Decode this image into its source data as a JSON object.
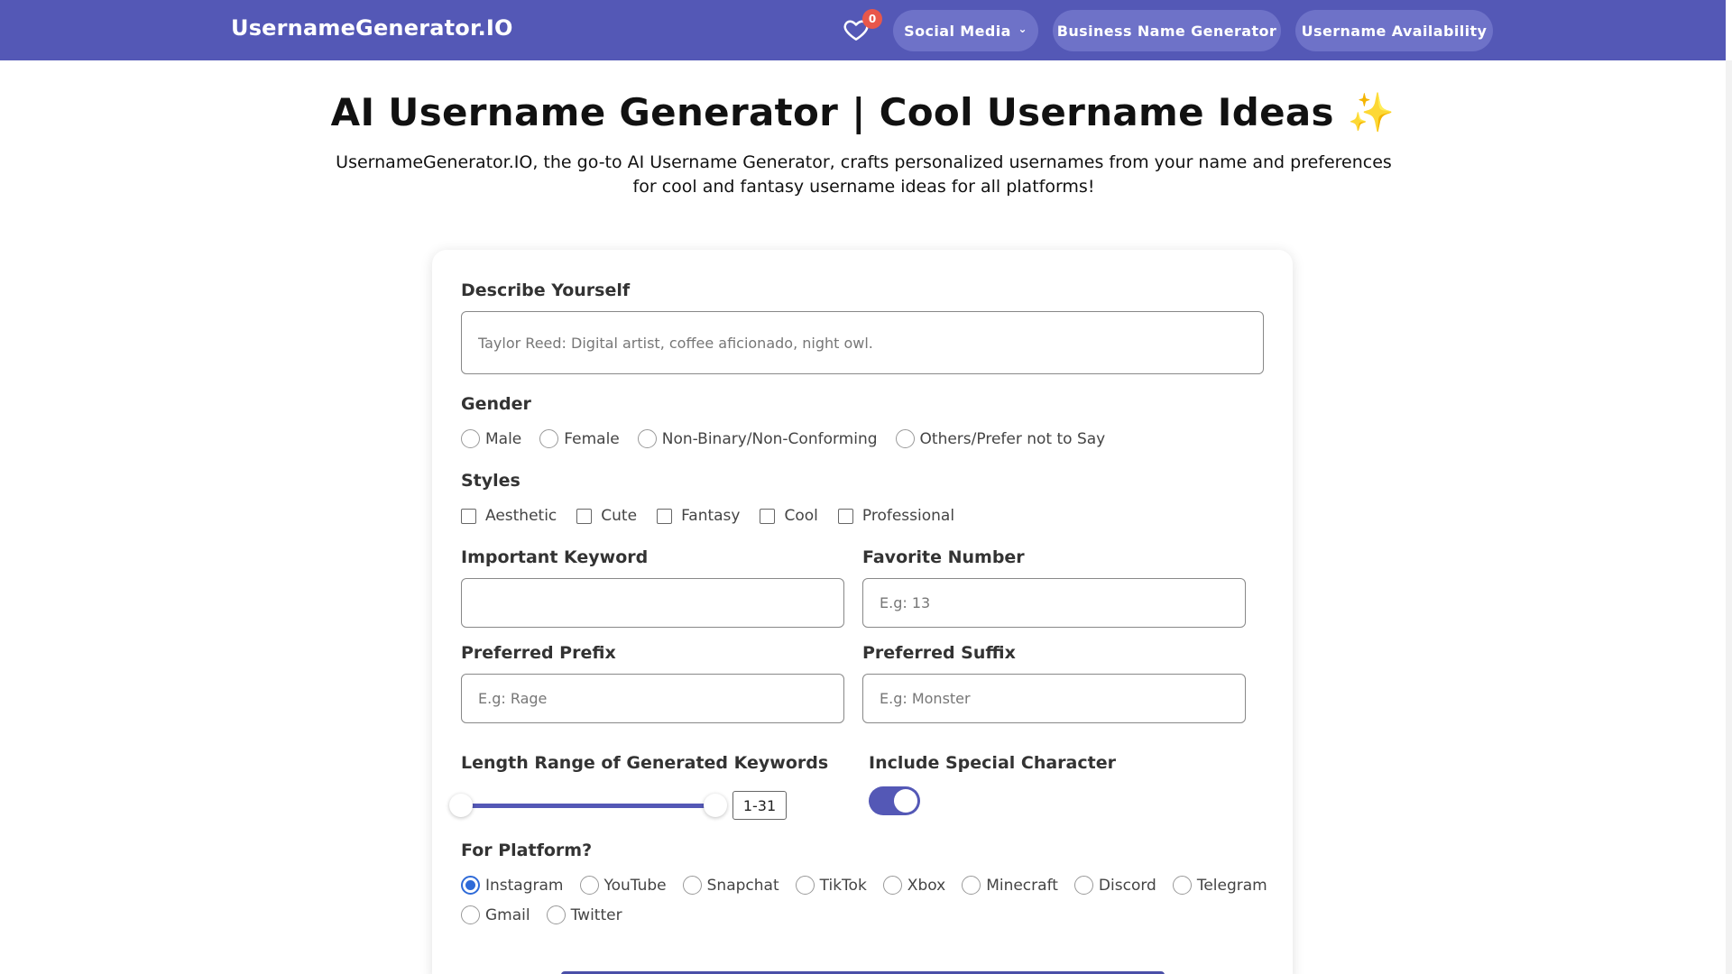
{
  "nav": {
    "brand": "UsernameGenerator.IO",
    "favorites_count": "0",
    "social_media": "Social Media",
    "business_name_generator": "Business Name Generator",
    "username_availability": "Username Availability"
  },
  "hero": {
    "title": "AI Username Generator | Cool Username Ideas ✨",
    "subtitle": "UsernameGenerator.IO, the go-to AI Username Generator, crafts personalized usernames from your name and preferences for cool and fantasy username ideas for all platforms!"
  },
  "form": {
    "describe_label": "Describe Yourself",
    "describe_placeholder": "Taylor Reed: Digital artist, coffee aficionado, night owl.",
    "gender_label": "Gender",
    "gender_options": [
      "Male",
      "Female",
      "Non-Binary/Non-Conforming",
      "Others/Prefer not to Say"
    ],
    "styles_label": "Styles",
    "styles_options": [
      "Aesthetic",
      "Cute",
      "Fantasy",
      "Cool",
      "Professional"
    ],
    "keyword_label": "Important Keyword",
    "keyword_value": "",
    "number_label": "Favorite Number",
    "number_placeholder": "E.g: 13",
    "prefix_label": "Preferred Prefix",
    "prefix_placeholder": "E.g: Rage",
    "suffix_label": "Preferred Suffix",
    "suffix_placeholder": "E.g: Monster",
    "length_label": "Length Range of Generated Keywords",
    "length_range": "1-31",
    "special_label": "Include Special Character",
    "special_enabled": true,
    "platform_label": "For Platform?",
    "platforms_row1": [
      "Instagram",
      "YouTube",
      "Snapchat",
      "TikTok",
      "Xbox",
      "Minecraft",
      "Discord",
      "Telegram"
    ],
    "platforms_row2": [
      "Gmail",
      "Twitter"
    ],
    "selected_platform": "Instagram"
  },
  "colors": {
    "brand": "#5458b6",
    "badge": "#e8574b",
    "radio_selected": "#2f6bd8"
  },
  "icons": {
    "favorites": "heart-icon",
    "dropdown": "chevron-down-icon"
  }
}
